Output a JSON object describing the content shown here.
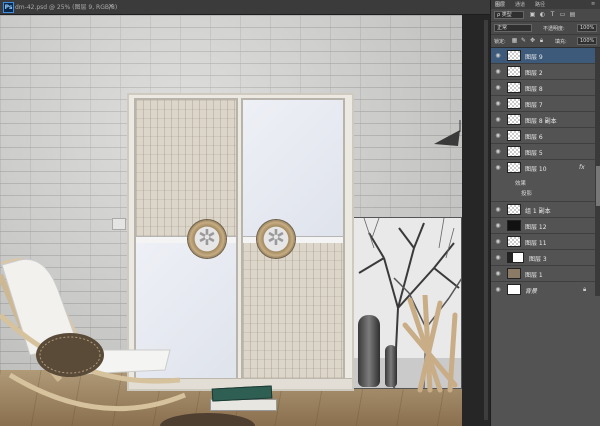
{
  "document": {
    "tab_icon": "Ps",
    "tab_title": "dm-42.psd @ 25% (图层 9, RGB/8)",
    "close": "×"
  },
  "panel": {
    "tabs": [
      "图层",
      "通道",
      "路径"
    ],
    "kind_filter": "ρ 类型",
    "blend_mode": "正常",
    "opacity_label": "不透明度:",
    "opacity_value": "100%",
    "lock_label": "锁定:",
    "fill_label": "填充:",
    "fill_value": "100%",
    "layers": [
      {
        "name": "图层 9",
        "selected": true
      },
      {
        "name": "图层 2"
      },
      {
        "name": "图层 8"
      },
      {
        "name": "图层 7"
      },
      {
        "name": "图层 8 副本"
      },
      {
        "name": "图层 6"
      },
      {
        "name": "图层 5"
      },
      {
        "name": "图层 10",
        "fx": "fx"
      },
      {
        "name": "组 1 副本"
      },
      {
        "name": "图层 12"
      },
      {
        "name": "图层 11"
      },
      {
        "name": "图层 3"
      },
      {
        "name": "图层 1"
      },
      {
        "name": "背景"
      }
    ],
    "effects_label": "效果",
    "effect_item": "投影"
  },
  "colors": {
    "panel_bg": "#535353",
    "selected_layer": "#3d5a7a",
    "canvas_frame": "#282828"
  }
}
